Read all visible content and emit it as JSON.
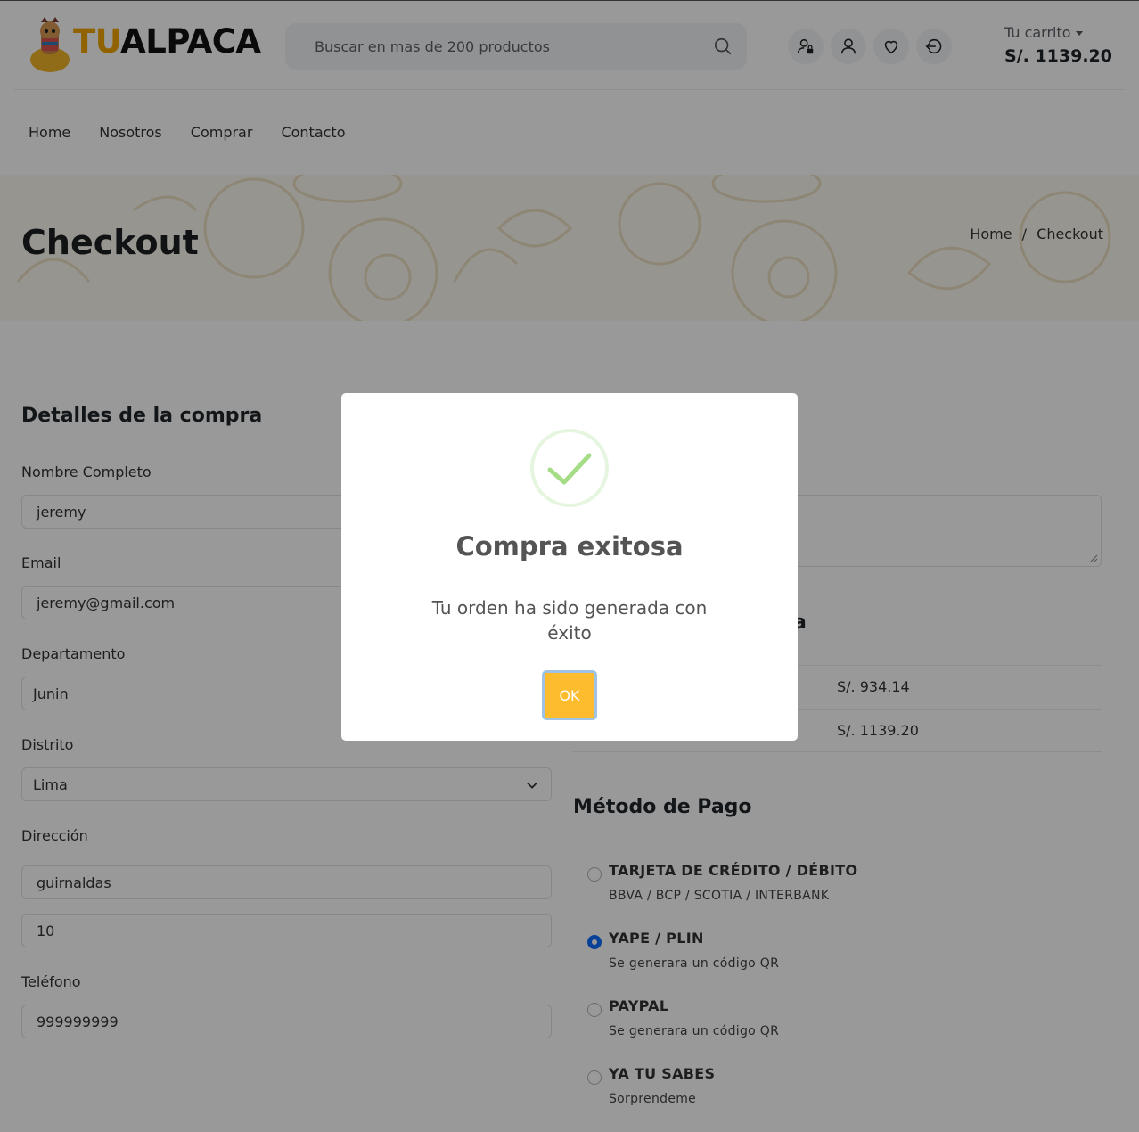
{
  "header": {
    "logo": {
      "part1": "TU",
      "part2": "ALPACA"
    },
    "search": {
      "placeholder": "Buscar en mas de 200 productos"
    },
    "cart": {
      "label": "Tu carrito",
      "total": "S/. 1139.20"
    }
  },
  "nav": [
    "Home",
    "Nosotros",
    "Comprar",
    "Contacto"
  ],
  "banner": {
    "title": "Checkout",
    "breadcrumb": {
      "home": "Home",
      "sep": "/",
      "current": "Checkout"
    }
  },
  "form": {
    "title": "Detalles de la compra",
    "fields": [
      {
        "label": "Nombre Completo",
        "value": "jeremy"
      },
      {
        "label": "Email",
        "value": "jeremy@gmail.com"
      },
      {
        "label": "Departamento",
        "value": "Junin"
      },
      {
        "label": "Distrito",
        "value": "Lima"
      },
      {
        "label": "Dirección",
        "value": "guirnaldas",
        "value2": "10"
      },
      {
        "label": "Teléfono",
        "value": "999999999"
      }
    ]
  },
  "summary": {
    "title_partial": "a",
    "rows": [
      "S/. 934.14",
      "S/. 1139.20"
    ]
  },
  "payment": {
    "title": "Método de Pago",
    "methods": [
      {
        "name": "TARJETA DE CRÉDITO / DÉBITO",
        "desc": "BBVA / BCP / SCOTIA / INTERBANK",
        "checked": false
      },
      {
        "name": "YAPE / PLIN",
        "desc": "Se generara un código QR",
        "checked": true
      },
      {
        "name": "PAYPAL",
        "desc": "Se generara un código QR",
        "checked": false
      },
      {
        "name": "YA TU SABES",
        "desc": "Sorprendeme",
        "checked": false
      }
    ]
  },
  "modal": {
    "title": "Compra exitosa",
    "text": "Tu orden ha sido generada con éxito",
    "ok": "OK"
  },
  "colors": {
    "accent": "#fcbc2d",
    "success": "#a5dc86",
    "radio": "#0d6efd"
  }
}
